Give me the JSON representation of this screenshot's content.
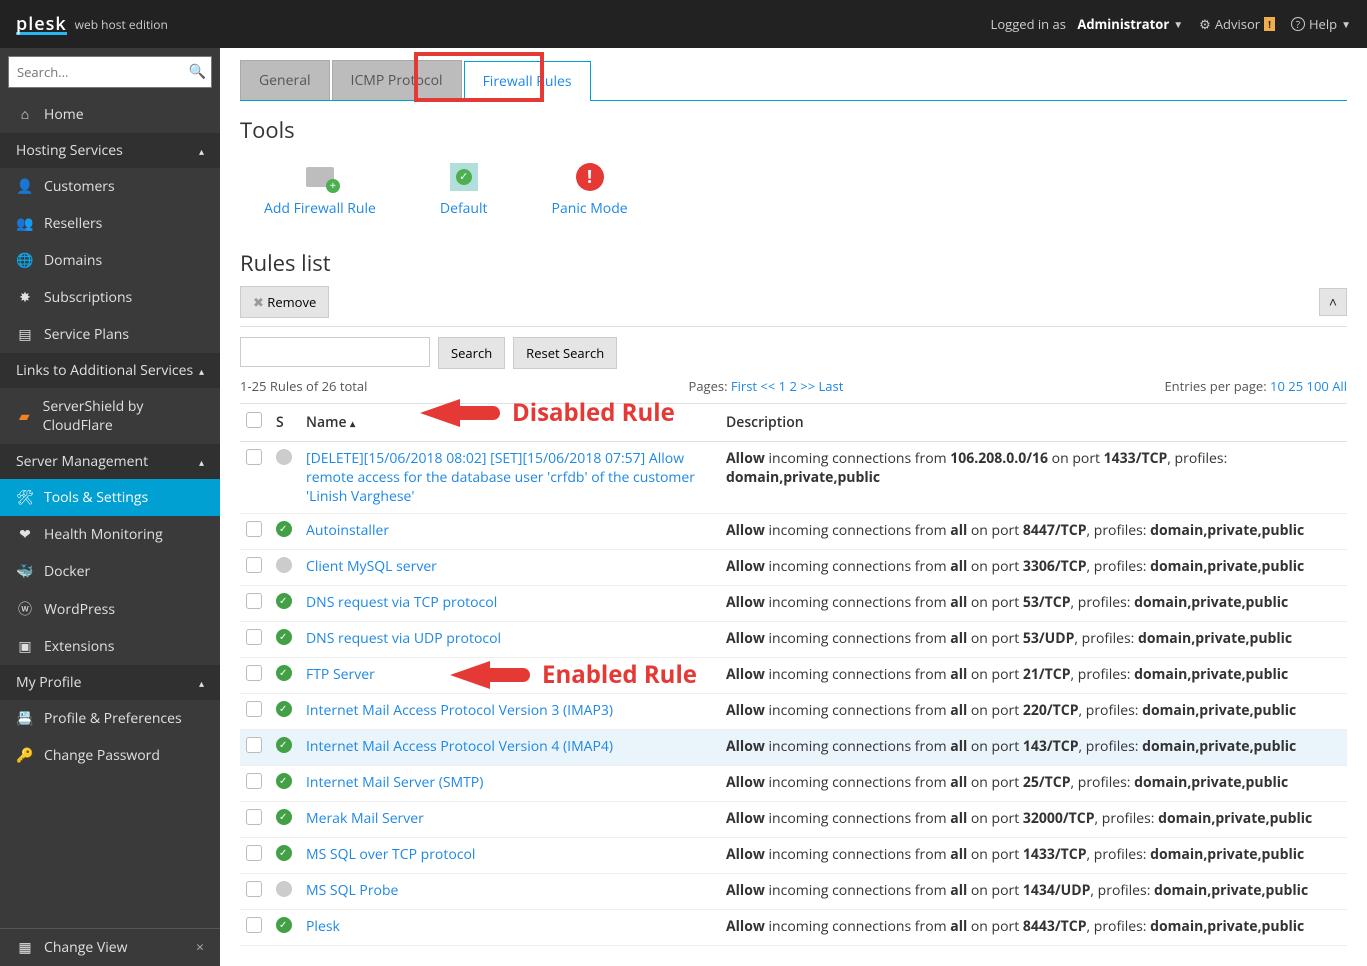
{
  "topbar": {
    "brand": "plesk",
    "edition": "web host edition",
    "logged_in_prefix": "Logged in as",
    "user": "Administrator",
    "advisor": "Advisor",
    "help": "Help"
  },
  "sidebar": {
    "search_placeholder": "Search...",
    "home": "Home",
    "section_hosting": "Hosting Services",
    "hosting_items": [
      "Customers",
      "Resellers",
      "Domains",
      "Subscriptions",
      "Service Plans"
    ],
    "section_links": "Links to Additional Services",
    "links_items": [
      "ServerShield by CloudFlare"
    ],
    "section_server": "Server Management",
    "server_items": [
      "Tools & Settings",
      "Health Monitoring",
      "Docker",
      "WordPress",
      "Extensions"
    ],
    "active_server_item_index": 0,
    "section_profile": "My Profile",
    "profile_items": [
      "Profile & Preferences",
      "Change Password"
    ],
    "change_view": "Change View"
  },
  "tabs": {
    "items": [
      "General",
      "ICMP Protocol",
      "Firewall Rules"
    ],
    "active_index": 2
  },
  "tools": {
    "heading": "Tools",
    "items": [
      {
        "label": "Add Firewall Rule",
        "icon": "firewall-add-icon",
        "color": "#9e9e9e"
      },
      {
        "label": "Default",
        "icon": "default-icon",
        "color": "#4caf50"
      },
      {
        "label": "Panic Mode",
        "icon": "panic-icon",
        "color": "#e53935"
      }
    ]
  },
  "rules": {
    "heading": "Rules list",
    "remove_btn": "Remove",
    "search_btn": "Search",
    "reset_btn": "Reset Search",
    "count_text": "1-25 Rules of 26 total",
    "pages_label": "Pages:",
    "pages_links": "First << 1 2 >> Last",
    "entries_label": "Entries per page:",
    "entries_links": "10 25 100 All",
    "cols": {
      "s": "S",
      "name": "Name",
      "desc": "Description"
    },
    "rows": [
      {
        "status": "off",
        "name": "[DELETE][15/06/2018 08:02] [SET][15/06/2018 07:57] Allow remote access for the database user 'crfdb' of the customer 'Linish Varghese'",
        "allow_src": "106.208.0.0/16",
        "port": "1433/TCP",
        "profiles": "domain,private,public"
      },
      {
        "status": "on",
        "name": "Autoinstaller",
        "allow_src": "all",
        "port": "8447/TCP",
        "profiles": "domain,private,public"
      },
      {
        "status": "off",
        "name": "Client MySQL server",
        "allow_src": "all",
        "port": "3306/TCP",
        "profiles": "domain,private,public"
      },
      {
        "status": "on",
        "name": "DNS request via TCP protocol",
        "allow_src": "all",
        "port": "53/TCP",
        "profiles": "domain,private,public"
      },
      {
        "status": "on",
        "name": "DNS request via UDP protocol",
        "allow_src": "all",
        "port": "53/UDP",
        "profiles": "domain,private,public"
      },
      {
        "status": "on",
        "name": "FTP Server",
        "allow_src": "all",
        "port": "21/TCP",
        "profiles": "domain,private,public"
      },
      {
        "status": "on",
        "name": "Internet Mail Access Protocol Version 3 (IMAP3)",
        "allow_src": "all",
        "port": "220/TCP",
        "profiles": "domain,private,public"
      },
      {
        "status": "on",
        "name": "Internet Mail Access Protocol Version 4 (IMAP4)",
        "allow_src": "all",
        "port": "143/TCP",
        "profiles": "domain,private,public",
        "highlighted": true
      },
      {
        "status": "on",
        "name": "Internet Mail Server (SMTP)",
        "allow_src": "all",
        "port": "25/TCP",
        "profiles": "domain,private,public"
      },
      {
        "status": "on",
        "name": "Merak Mail Server",
        "allow_src": "all",
        "port": "32000/TCP",
        "profiles": "domain,private,public"
      },
      {
        "status": "on",
        "name": "MS SQL over TCP protocol",
        "allow_src": "all",
        "port": "1433/TCP",
        "profiles": "domain,private,public"
      },
      {
        "status": "off",
        "name": "MS SQL Probe",
        "allow_src": "all",
        "port": "1434/UDP",
        "profiles": "domain,private,public"
      },
      {
        "status": "on",
        "name": "Plesk",
        "allow_src": "all",
        "port": "8443/TCP",
        "profiles": "domain,private,public"
      }
    ]
  },
  "annotations": {
    "disabled": "Disabled Rule",
    "enabled": "Enabled Rule"
  }
}
